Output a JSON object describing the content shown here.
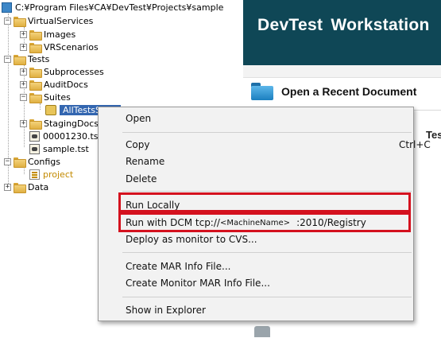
{
  "tree": {
    "root": "C:¥Program Files¥CA¥DevTest¥Projects¥sample",
    "nodes": [
      {
        "label": "VirtualServices"
      },
      {
        "label": "Images"
      },
      {
        "label": "VRScenarios"
      },
      {
        "label": "Tests"
      },
      {
        "label": "Subprocesses"
      },
      {
        "label": "AuditDocs"
      },
      {
        "label": "Suites"
      },
      {
        "label": "AllTestsSuite"
      },
      {
        "label": "StagingDocs"
      },
      {
        "label": "00001230.tst"
      },
      {
        "label": "sample.tst"
      },
      {
        "label": "Configs"
      },
      {
        "label": "project"
      },
      {
        "label": "Data"
      }
    ]
  },
  "workstation": {
    "title": "DevTest Workstation",
    "recent_label": "Open a Recent Document",
    "partial_label": "Test"
  },
  "context_menu": {
    "open": "Open",
    "copy": "Copy",
    "copy_shortcut": "Ctrl+C",
    "rename": "Rename",
    "delete": "Delete",
    "run_locally": "Run Locally",
    "run_dcm_prefix": "Run with DCM tcp://",
    "run_dcm_machine": "<MachineName>",
    "run_dcm_suffix": ":2010/Registry",
    "deploy": "Deploy as monitor to CVS...",
    "create_mar": "Create MAR Info File...",
    "create_monitor_mar": "Create Monitor MAR Info File...",
    "show_explorer": "Show in Explorer"
  },
  "colors": {
    "header_bg": "#0f4756",
    "highlight_box": "#d4111e",
    "selection": "#3366b0",
    "project_text": "#c38a00"
  }
}
